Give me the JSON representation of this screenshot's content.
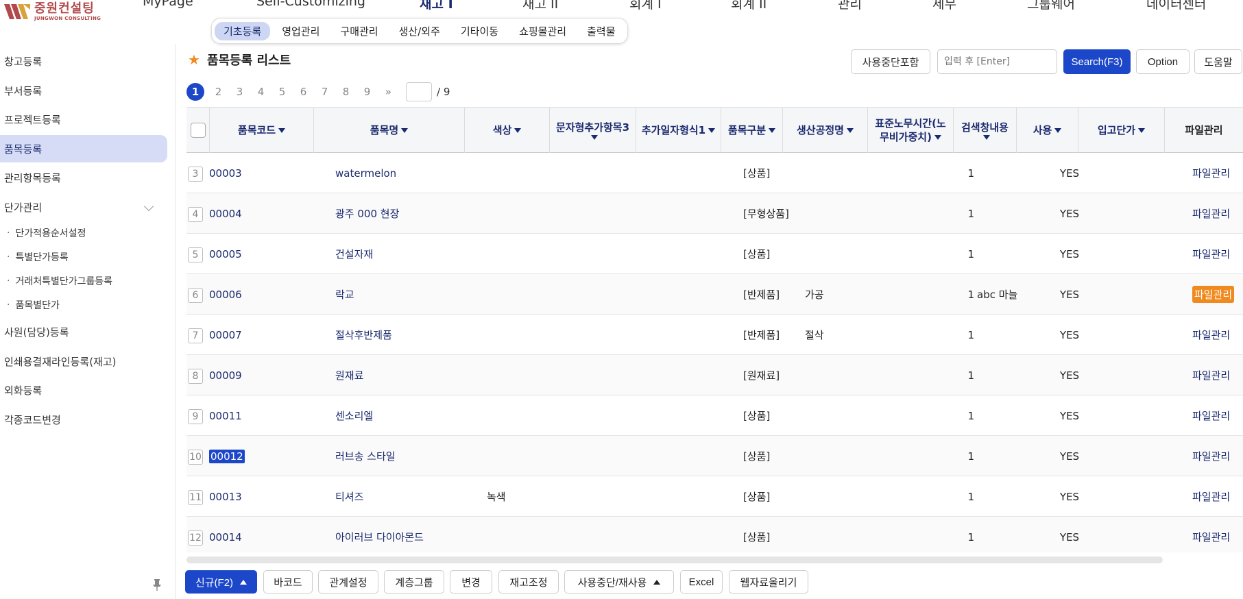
{
  "logo": {
    "ko": "중원컨설팅",
    "en": "JUNGWON CONSULTING"
  },
  "main_menu": [
    "MyPage",
    "Self-Customizing",
    "재고 I",
    "재고 II",
    "회계 I",
    "회계 II",
    "관리",
    "세무",
    "그룹웨어",
    "데이터센터"
  ],
  "sub_menu": [
    "기초등록",
    "영업관리",
    "구매관리",
    "생산/외주",
    "기타이동",
    "쇼핑몰관리",
    "출력물"
  ],
  "sidebar": {
    "items": [
      "창고등록",
      "부서등록",
      "프로젝트등록",
      "품목등록",
      "관리항목등록",
      "단가관리",
      "사원(담당)등록",
      "인쇄용결재라인등록(재고)",
      "외화등록",
      "각종코드변경"
    ],
    "sub_items": [
      "단가적용순서설정",
      "특별단가등록",
      "거래처특별단가그룹등록",
      "품목별단가"
    ]
  },
  "page": {
    "title": "품목등록 리스트"
  },
  "toolbar": {
    "include_stopped": "사용중단포함",
    "search_placeholder": "입력 후 [Enter]",
    "search": "Search(F3)",
    "option": "Option",
    "help": "도움말"
  },
  "pager": {
    "pages": [
      "1",
      "2",
      "3",
      "4",
      "5",
      "6",
      "7",
      "8",
      "9"
    ],
    "next": "»",
    "total": "/ 9"
  },
  "columns": {
    "code": "품목코드",
    "name": "품목명",
    "color": "색상",
    "extra3": "문자형추가항목3",
    "date1": "추가일자형식1",
    "type": "품목구분",
    "process": "생산공정명",
    "labor_1": "표준노무시간(노",
    "labor_2": "무비가중치)",
    "search": "검색창내용",
    "use": "사용",
    "price": "입고단가",
    "file": "파일관리"
  },
  "rows": [
    {
      "num": "3",
      "code": "00003",
      "name": "watermelon",
      "color": "",
      "type": "[상품]",
      "process": "",
      "labor": "1",
      "search": "",
      "use": "YES",
      "file": "파일관리"
    },
    {
      "num": "4",
      "code": "00004",
      "name": "광주 000 현장",
      "color": "",
      "type": "[무형상품]",
      "process": "",
      "labor": "1",
      "search": "",
      "use": "YES",
      "file": "파일관리"
    },
    {
      "num": "5",
      "code": "00005",
      "name": "건설자재",
      "color": "",
      "type": "[상품]",
      "process": "",
      "labor": "1",
      "search": "",
      "use": "YES",
      "file": "파일관리"
    },
    {
      "num": "6",
      "code": "00006",
      "name": "락교",
      "color": "",
      "type": "[반제품]",
      "process": "가공",
      "labor": "1",
      "search": "abc 마늘",
      "use": "YES",
      "file": "파일관리"
    },
    {
      "num": "7",
      "code": "00007",
      "name": "절삭후반제품",
      "color": "",
      "type": "[반제품]",
      "process": "절삭",
      "labor": "1",
      "search": "",
      "use": "YES",
      "file": "파일관리"
    },
    {
      "num": "8",
      "code": "00009",
      "name": "원재료",
      "color": "",
      "type": "[원재료]",
      "process": "",
      "labor": "1",
      "search": "",
      "use": "YES",
      "file": "파일관리"
    },
    {
      "num": "9",
      "code": "00011",
      "name": "센소리엘",
      "color": "",
      "type": "[상품]",
      "process": "",
      "labor": "1",
      "search": "",
      "use": "YES",
      "file": "파일관리"
    },
    {
      "num": "10",
      "code": "00012",
      "name": "러브송 스타일",
      "color": "",
      "type": "[상품]",
      "process": "",
      "labor": "1",
      "search": "",
      "use": "YES",
      "file": "파일관리"
    },
    {
      "num": "11",
      "code": "00013",
      "name": "티셔즈",
      "color": "녹색",
      "type": "[상품]",
      "process": "",
      "labor": "1",
      "search": "",
      "use": "YES",
      "file": "파일관리"
    },
    {
      "num": "12",
      "code": "00014",
      "name": "아이러브 다이아몬드",
      "color": "",
      "type": "[상품]",
      "process": "",
      "labor": "1",
      "search": "",
      "use": "YES",
      "file": "파일관리"
    }
  ],
  "bottom": {
    "new": "신규(F2)",
    "barcode": "바코드",
    "relation": "관계설정",
    "hierarchy": "계층그룹",
    "change": "변경",
    "stock_adjust": "재고조정",
    "stop_reuse": "사용중단/재사용",
    "excel": "Excel",
    "web_upload": "웹자료올리기"
  },
  "colors": {
    "primary": "#1c47c9",
    "accent": "#f08a1e",
    "brand": "#b2494a",
    "active_bg": "#d6dcf5"
  }
}
